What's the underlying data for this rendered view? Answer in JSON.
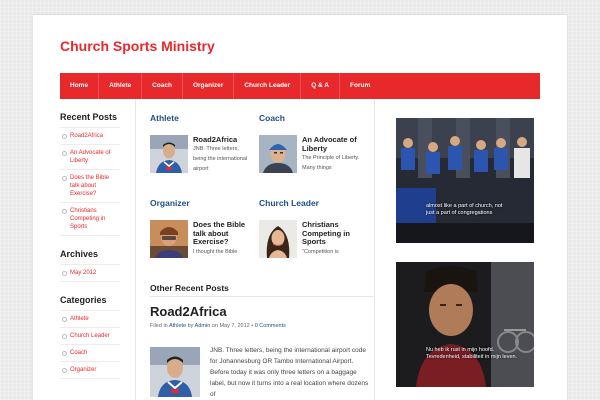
{
  "site": {
    "title": "Church Sports Ministry"
  },
  "nav": [
    "Home",
    "Athlete",
    "Coach",
    "Organizer",
    "Church Leader",
    "Q & A",
    "Forum"
  ],
  "sidebar": {
    "recent_posts": {
      "title": "Recent Posts",
      "items": [
        "Road2Africa",
        "An Advocate of Liberty",
        "Does the Bible talk about Exercise?",
        "Christians Competing in Sports"
      ]
    },
    "archives": {
      "title": "Archives",
      "items": [
        "May 2012"
      ]
    },
    "categories": {
      "title": "Categories",
      "items": [
        "Athlete",
        "Church Leader",
        "Coach",
        "Organizer"
      ]
    }
  },
  "sections": {
    "athlete": {
      "title": "Athlete",
      "post_title": "Road2Africa",
      "excerpt": "JNB. Three letters, being the international airport"
    },
    "coach": {
      "title": "Coach",
      "post_title": "An Advocate of Liberty",
      "excerpt": "The Principle of Liberty.  Many things"
    },
    "organizer": {
      "title": "Organizer",
      "post_title": "Does the Bible talk about Exercise?",
      "excerpt": "I thought the Bible"
    },
    "church_leader": {
      "title": "Church Leader",
      "post_title": "Christians Competing in Sports",
      "excerpt": "\"Competition is"
    }
  },
  "other": {
    "heading": "Other Recent Posts",
    "post_title": "Road2Africa",
    "meta": {
      "filed_in": "Filed in",
      "category": "Athlete",
      "by": "by",
      "author": "Admin",
      "on": "on May 7, 2012",
      "sep": "•",
      "comments": "0 Comments"
    },
    "excerpt": "JNB. Three letters, being the international airport code for Johannesburg OR Tambo International Airport. Before today it was only three letters on a baggage label, but now it turns into a real location where dozens of"
  },
  "videos": [
    {
      "caption_line1": "almost like a part of church, not",
      "caption_line2": "just a part of congregations"
    },
    {
      "caption_line1": "Nu heb ik rust in mijn hoofd.",
      "caption_line2": "Tevredenheid, stabiliteit in mijn leven."
    }
  ]
}
